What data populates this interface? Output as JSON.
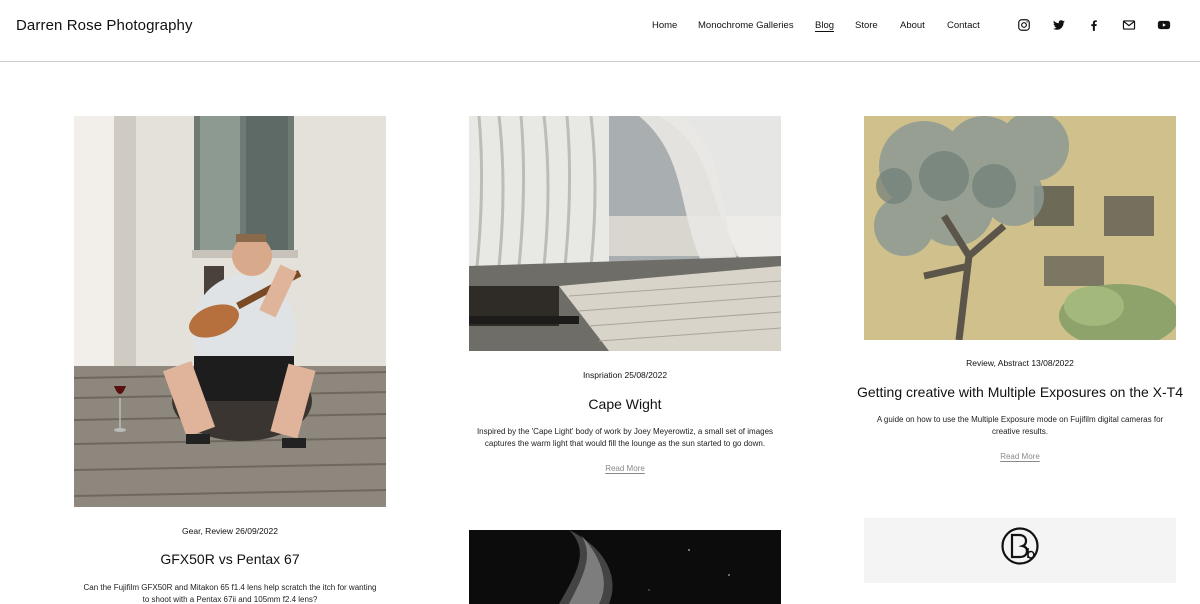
{
  "site": {
    "title": "Darren Rose Photography"
  },
  "nav": {
    "items": [
      {
        "label": "Home"
      },
      {
        "label": "Monochrome Galleries"
      },
      {
        "label": "Blog"
      },
      {
        "label": "Store"
      },
      {
        "label": "About"
      },
      {
        "label": "Contact"
      }
    ],
    "active": "Blog"
  },
  "social": [
    "instagram-icon",
    "twitter-icon",
    "facebook-icon",
    "email-icon",
    "youtube-icon"
  ],
  "posts": [
    {
      "meta": "Gear, Review 26/09/2022",
      "title": "GFX50R vs Pentax 67",
      "excerpt_line1": "Can the Fujifilm GFX50R and Mitakon 65 f1.4 lens help scratch the itch for wanting",
      "excerpt_line2": "to shoot with a Pentax 67ii and 105mm f2.4 lens?"
    },
    {
      "meta": "Inspriation 25/08/2022",
      "title": "Cape Wight",
      "excerpt_line1": "Inspired by the 'Cape Light' body of work by Joey Meyerowtiz, a small set of images",
      "excerpt_line2": "captures the warm light that would fill the lounge as the sun started to go down.",
      "read_more": "Read More"
    },
    {
      "meta": "Review, Abstract 13/08/2022",
      "title": "Getting creative with Multiple Exposures on the X-T4",
      "excerpt_line1": "A guide on how to use the Multiple Exposure mode on Fujifilm digital cameras for",
      "excerpt_line2": "creative results.",
      "read_more": "Read More"
    }
  ],
  "colors": {
    "text": "#111111",
    "divider": "#cfcfcf",
    "link_muted": "#8a8a8a"
  }
}
